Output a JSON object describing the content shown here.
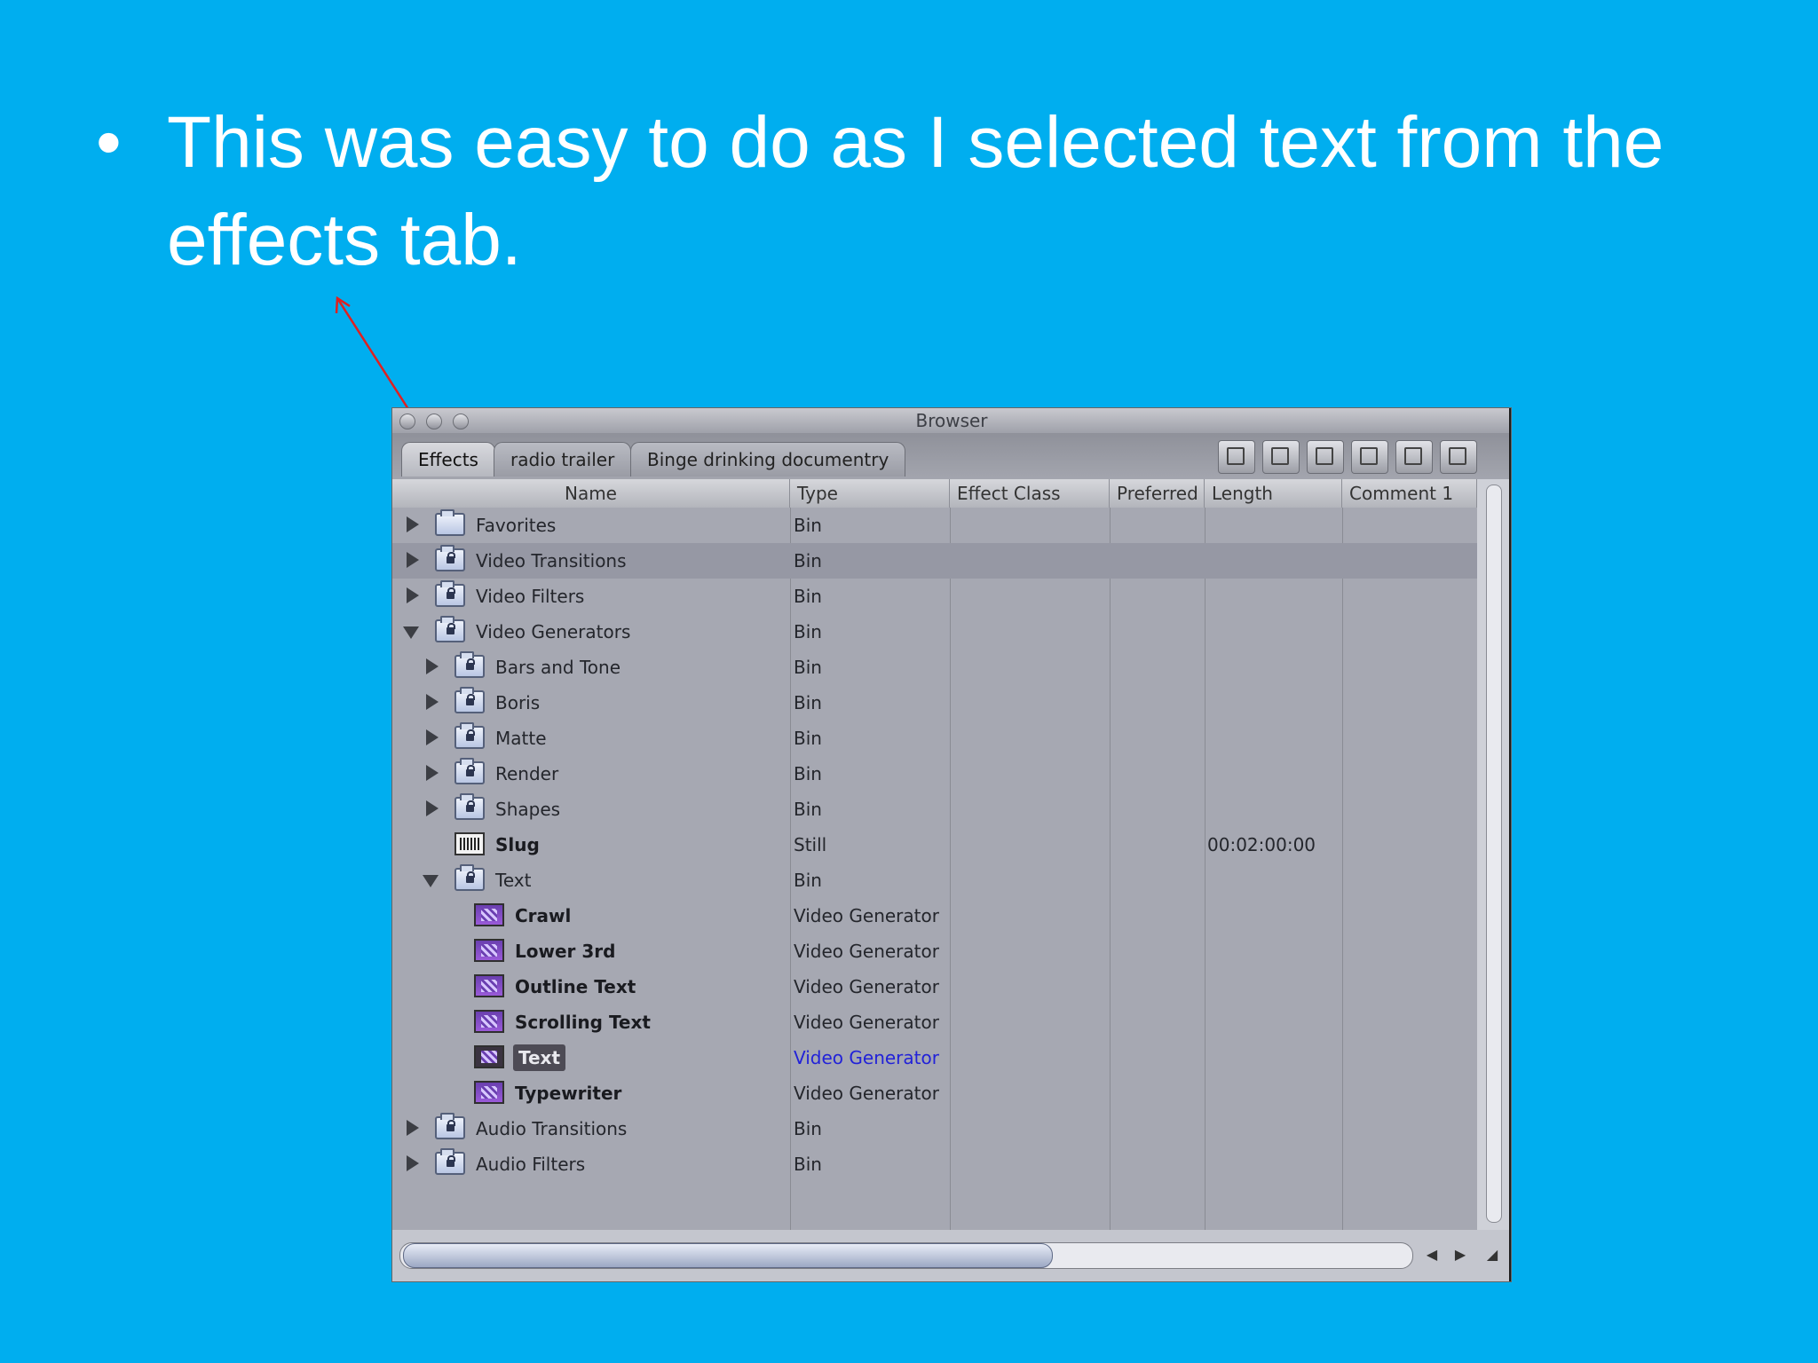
{
  "slide": {
    "bullet": "•",
    "text": "This was easy to do as I selected text from the effects tab."
  },
  "window": {
    "title": "Browser",
    "tabs": [
      {
        "label": "Effects",
        "active": true
      },
      {
        "label": "radio trailer",
        "active": false
      },
      {
        "label": "Binge drinking documentry",
        "active": false
      }
    ],
    "toolbar": [
      "toolbar-icon-1",
      "toolbar-icon-2",
      "toolbar-icon-3",
      "toolbar-icon-4",
      "toolbar-icon-5",
      "toolbar-icon-6"
    ],
    "columns": {
      "name": "Name",
      "type": "Type",
      "effect_class": "Effect Class",
      "preferred": "Preferred",
      "length": "Length",
      "comment1": "Comment 1"
    },
    "rows": [
      {
        "name": "Favorites",
        "type": "Bin",
        "level": 0,
        "disclosure": "closed",
        "icon": "folder",
        "bold": false
      },
      {
        "name": "Video Transitions",
        "type": "Bin",
        "level": 0,
        "disclosure": "closed",
        "icon": "locked-bin",
        "bold": false
      },
      {
        "name": "Video Filters",
        "type": "Bin",
        "level": 0,
        "disclosure": "closed",
        "icon": "locked-bin",
        "bold": false
      },
      {
        "name": "Video Generators",
        "type": "Bin",
        "level": 0,
        "disclosure": "open",
        "icon": "locked-bin",
        "bold": false
      },
      {
        "name": "Bars and Tone",
        "type": "Bin",
        "level": 1,
        "disclosure": "closed",
        "icon": "locked-bin",
        "bold": false
      },
      {
        "name": "Boris",
        "type": "Bin",
        "level": 1,
        "disclosure": "closed",
        "icon": "locked-bin",
        "bold": false
      },
      {
        "name": "Matte",
        "type": "Bin",
        "level": 1,
        "disclosure": "closed",
        "icon": "locked-bin",
        "bold": false
      },
      {
        "name": "Render",
        "type": "Bin",
        "level": 1,
        "disclosure": "closed",
        "icon": "locked-bin",
        "bold": false
      },
      {
        "name": "Shapes",
        "type": "Bin",
        "level": 1,
        "disclosure": "closed",
        "icon": "locked-bin",
        "bold": false
      },
      {
        "name": "Slug",
        "type": "Still",
        "level": 1,
        "disclosure": "none",
        "icon": "slug",
        "bold": true,
        "length": "00:02:00:00"
      },
      {
        "name": "Text",
        "type": "Bin",
        "level": 1,
        "disclosure": "open",
        "icon": "locked-bin",
        "bold": false
      },
      {
        "name": "Crawl",
        "type": "Video Generator",
        "level": 2,
        "disclosure": "none",
        "icon": "generator",
        "bold": true
      },
      {
        "name": "Lower 3rd",
        "type": "Video Generator",
        "level": 2,
        "disclosure": "none",
        "icon": "generator",
        "bold": true
      },
      {
        "name": "Outline Text",
        "type": "Video Generator",
        "level": 2,
        "disclosure": "none",
        "icon": "generator",
        "bold": true
      },
      {
        "name": "Scrolling Text",
        "type": "Video Generator",
        "level": 2,
        "disclosure": "none",
        "icon": "generator",
        "bold": true
      },
      {
        "name": "Text",
        "type": "Video Generator",
        "level": 2,
        "disclosure": "none",
        "icon": "generator",
        "bold": true,
        "selected": true
      },
      {
        "name": "Typewriter",
        "type": "Video Generator",
        "level": 2,
        "disclosure": "none",
        "icon": "generator",
        "bold": true
      },
      {
        "name": "Audio Transitions",
        "type": "Bin",
        "level": 0,
        "disclosure": "closed",
        "icon": "locked-bin",
        "bold": false
      },
      {
        "name": "Audio Filters",
        "type": "Bin",
        "level": 0,
        "disclosure": "closed",
        "icon": "locked-bin",
        "bold": false
      }
    ],
    "colors": {
      "background": "#00AEEF",
      "selection_type": "#2222d8",
      "arrow": "#e02020"
    }
  }
}
